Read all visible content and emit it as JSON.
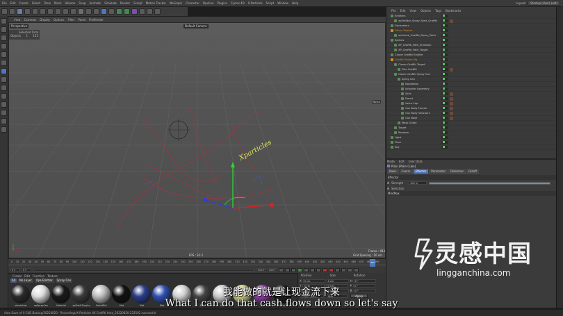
{
  "menubar": {
    "items": [
      "File",
      "Edit",
      "Create",
      "Select",
      "Tools",
      "Mesh",
      "Volume",
      "Snap",
      "Animate",
      "Simulate",
      "Render",
      "Sculpt",
      "Motion Tracker",
      "MoGraph",
      "Character",
      "Pipeline",
      "Plugins",
      "Cycles 4D",
      "X-Particles",
      "Script",
      "Window",
      "Help"
    ],
    "layout_label": "Layout:",
    "layout_value": "Startup (User) (old)"
  },
  "viewport": {
    "menu": [
      "View",
      "Cameras",
      "Display",
      "Options",
      "Filter",
      "Panel",
      "ProRender"
    ],
    "name": "Perspective",
    "camera_label": "Default Camera",
    "stats_title": "Selected Total",
    "stats_label": "Objects",
    "stats_sel": "1",
    "stats_total": "153",
    "side_label": "Noise",
    "fps": "FPS : 31.2",
    "frame_label": "Frame : 483",
    "grid_label": "Grid Spacing : 10 cm",
    "scene_text": "Xparticles"
  },
  "timeline": {
    "ticks": [
      "0",
      "10",
      "20",
      "30",
      "40",
      "50",
      "60",
      "70",
      "80",
      "90",
      "100",
      "110",
      "120",
      "130",
      "140",
      "150",
      "160",
      "170",
      "180",
      "190",
      "200",
      "210",
      "220",
      "230",
      "240",
      "250",
      "260",
      "270",
      "280",
      "290",
      "300",
      "310",
      "320",
      "330",
      "340",
      "350",
      "360",
      "370",
      "380",
      "390",
      "400",
      "410",
      "420",
      "430",
      "440",
      "450",
      "460",
      "470",
      "480",
      "490"
    ],
    "current_frame": "483 F",
    "start_frame": "0 F",
    "mid_frame": "0 F",
    "end_frame": "500 F",
    "end_frame2": "500 F"
  },
  "materials": {
    "menu": [
      "Create",
      "Edit",
      "Function",
      "Texture"
    ],
    "filters": [
      "All",
      "No Layer",
      "Xpa Emitter",
      "Spray Can"
    ],
    "items": [
      "simulation",
      "xpSprayCan",
      "Material",
      "xpShell Physics",
      "PortalDirt",
      "Mat",
      "Mat",
      "Mat",
      "Mat",
      "Mat",
      "Mat",
      "Mat",
      "Mat",
      "Mat"
    ]
  },
  "coordinates": {
    "headers": [
      "Position",
      "Size",
      "Rotation"
    ],
    "rows": [
      {
        "axis": "X",
        "pos": "0 cm",
        "size": "0 cm",
        "rot_axis": "H",
        "rot": "0 °"
      },
      {
        "axis": "Y",
        "pos": "0 cm",
        "size": "0 cm",
        "rot_axis": "P",
        "rot": "0 °"
      },
      {
        "axis": "Z",
        "pos": "0 cm",
        "size": "0 cm",
        "rot_axis": "B",
        "rot": "0 °"
      }
    ],
    "mode": "Object (Rel)",
    "size_mode": "Size",
    "apply": "Apply"
  },
  "objects": {
    "menu": [
      "File",
      "Edit",
      "View",
      "Objects",
      "Tags",
      "Bookmarks"
    ],
    "rows": [
      {
        "label": "Emitters",
        "indent": 1,
        "hl": false,
        "tag": false
      },
      {
        "label": "xpEmitter_Spray_Start_Graffiti",
        "indent": 2,
        "hl": false,
        "tag": true
      },
      {
        "label": "Generators",
        "indent": 1,
        "hl": false,
        "tag": false
      },
      {
        "label": "Other Objects",
        "indent": 1,
        "hl": true,
        "tag": false
      },
      {
        "label": "xpCache_Graffiti_Spray_Paint",
        "indent": 2,
        "hl": false,
        "tag": false
      },
      {
        "label": "Splines",
        "indent": 1,
        "hl": false,
        "tag": false
      },
      {
        "label": "XP_Graffiti_Path_Emission",
        "indent": 2,
        "hl": false,
        "tag": false
      },
      {
        "label": "XP_Graffiti_Path_Target",
        "indent": 2,
        "hl": false,
        "tag": false
      },
      {
        "label": "Cloner Graffiti Emitter",
        "indent": 1,
        "hl": false,
        "tag": false
      },
      {
        "label": "Graffiti Stroke Mg",
        "indent": 1,
        "hl": true,
        "tag": false
      },
      {
        "label": "Cloner Graffiti Target",
        "indent": 2,
        "hl": false,
        "tag": false
      },
      {
        "label": "Disc Graffiti",
        "indent": 3,
        "hl": false,
        "tag": true
      },
      {
        "label": "Cloner Graffiti Spray Can",
        "indent": 2,
        "hl": false,
        "tag": false
      },
      {
        "label": "Spray Can",
        "indent": 3,
        "hl": false,
        "tag": false
      },
      {
        "label": "Nozzlebox",
        "indent": 4,
        "hl": false,
        "tag": false
      },
      {
        "label": "Actuator Assembly",
        "indent": 4,
        "hl": false,
        "tag": false
      },
      {
        "label": "Skirt",
        "indent": 4,
        "hl": false,
        "tag": true
      },
      {
        "label": "Donut",
        "indent": 4,
        "hl": false,
        "tag": true
      },
      {
        "label": "Valve Cap",
        "indent": 4,
        "hl": false,
        "tag": true
      },
      {
        "label": "Can Body Fender",
        "indent": 4,
        "hl": false,
        "tag": true
      },
      {
        "label": "Can Body Viewport",
        "indent": 4,
        "hl": false,
        "tag": true
      },
      {
        "label": "Can Base",
        "indent": 4,
        "hl": false,
        "tag": true
      },
      {
        "label": "Mask Guide",
        "indent": 3,
        "hl": false,
        "tag": false
      },
      {
        "label": "Target",
        "indent": 2,
        "hl": false,
        "tag": false
      },
      {
        "label": "Random",
        "indent": 2,
        "hl": false,
        "tag": false
      },
      {
        "label": "Light",
        "indent": 1,
        "hl": false,
        "tag": false
      },
      {
        "label": "Floor",
        "indent": 1,
        "hl": false,
        "tag": false
      },
      {
        "label": "Sky",
        "indent": 1,
        "hl": false,
        "tag": false
      }
    ]
  },
  "attributes": {
    "menu": [
      "Mode",
      "Edit",
      "User Data"
    ],
    "title": "Plain [Plain Cube]",
    "tabs": [
      "Basic",
      "Coord.",
      "Effector",
      "Parameter",
      "Deformer",
      "Falloff"
    ],
    "active_tab": "Effector",
    "section": "Effector",
    "strength_label": "Strength",
    "strength_value": "100 %",
    "strength_fraction": 1.0,
    "selection_label": "Selection",
    "minmax_label": "Min/Max"
  },
  "status": "Auto Save of X-C4D Backup/20220820 - Recordings/X-Particles 4K Graffiti Intro_20220820-232502 successful",
  "watermark": {
    "text": "灵感中国",
    "url": "lingganchina.com"
  },
  "subtitles": {
    "zh": "我能做的就是让现金流下来",
    "en": "What I can do that cash flows down so let's say"
  },
  "colors": {
    "accent_orange": "#d88a18",
    "tab_active": "#4f77bd",
    "spline_red": "#b03040",
    "axis_green": "#2fd43a",
    "axis_blue": "#2b3ee0",
    "axis_red": "#e02020"
  }
}
